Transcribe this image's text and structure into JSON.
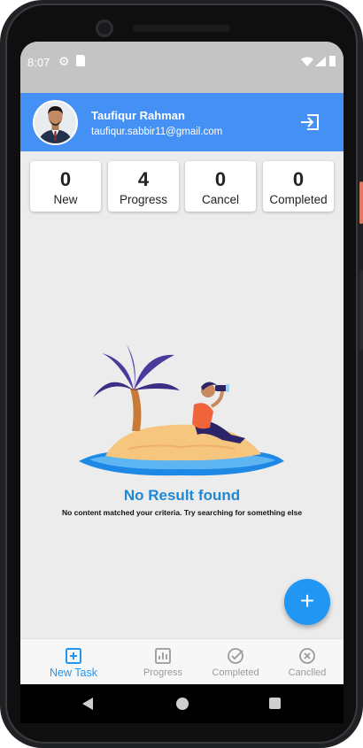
{
  "status_bar": {
    "time": "8:07",
    "icons": [
      "gear-icon",
      "sd-card-icon",
      "wifi-icon",
      "signal-icon",
      "battery-icon"
    ]
  },
  "profile": {
    "name": "Taufiqur Rahman",
    "email": "taufiqur.sabbir11@gmail.com",
    "logout_icon": "logout-icon"
  },
  "summary_cards": [
    {
      "count": "0",
      "label": "New"
    },
    {
      "count": "4",
      "label": "Progress"
    },
    {
      "count": "0",
      "label": "Cancel"
    },
    {
      "count": "0",
      "label": "Completed"
    }
  ],
  "empty_state": {
    "title": "No Result found",
    "subtitle": "No content matched your criteria. Try searching for something else"
  },
  "fab": {
    "icon": "plus-icon",
    "symbol": "+"
  },
  "bottom_nav": {
    "active": "New Task",
    "items": [
      {
        "label": "New Task",
        "icon": "add-box-icon"
      },
      {
        "label": "Progress",
        "icon": "bar-chart-icon"
      },
      {
        "label": "Completed",
        "icon": "check-circle-icon"
      },
      {
        "label": "Canclled",
        "icon": "cancel-circle-icon"
      }
    ]
  },
  "colors": {
    "header": "#4490f4",
    "accent": "#2196f3",
    "background": "#ececec",
    "status_bar": "#c4c4c4",
    "inactive_nav": "#9a9a9a"
  }
}
